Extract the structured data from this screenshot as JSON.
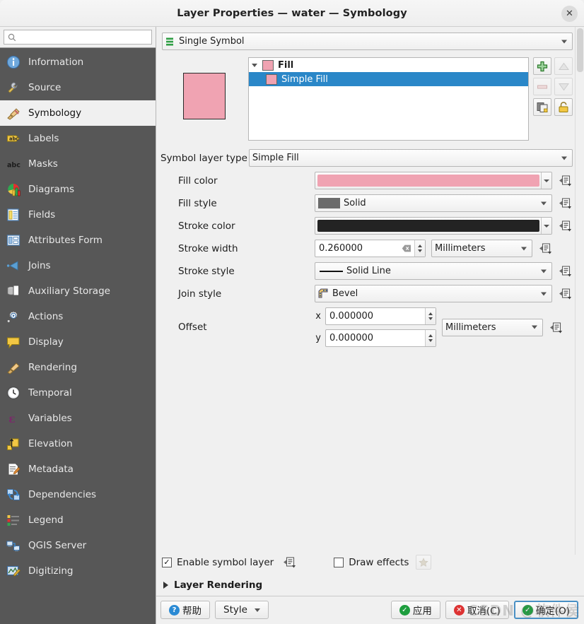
{
  "window": {
    "title": "Layer Properties — water — Symbology",
    "close_label": "✕"
  },
  "sidebar": {
    "search_value": "",
    "search_placeholder": "",
    "items": [
      {
        "label": "Information",
        "icon": "information-icon",
        "selected": false
      },
      {
        "label": "Source",
        "icon": "source-icon",
        "selected": false
      },
      {
        "label": "Symbology",
        "icon": "symbology-icon",
        "selected": true
      },
      {
        "label": "Labels",
        "icon": "labels-icon",
        "selected": false
      },
      {
        "label": "Masks",
        "icon": "masks-icon",
        "selected": false
      },
      {
        "label": "Diagrams",
        "icon": "diagrams-icon",
        "selected": false
      },
      {
        "label": "Fields",
        "icon": "fields-icon",
        "selected": false
      },
      {
        "label": "Attributes Form",
        "icon": "attributes-form-icon",
        "selected": false
      },
      {
        "label": "Joins",
        "icon": "joins-icon",
        "selected": false
      },
      {
        "label": "Auxiliary Storage",
        "icon": "auxiliary-storage-icon",
        "selected": false
      },
      {
        "label": "Actions",
        "icon": "actions-icon",
        "selected": false
      },
      {
        "label": "Display",
        "icon": "display-icon",
        "selected": false
      },
      {
        "label": "Rendering",
        "icon": "rendering-icon",
        "selected": false
      },
      {
        "label": "Temporal",
        "icon": "temporal-icon",
        "selected": false
      },
      {
        "label": "Variables",
        "icon": "variables-icon",
        "selected": false
      },
      {
        "label": "Elevation",
        "icon": "elevation-icon",
        "selected": false
      },
      {
        "label": "Metadata",
        "icon": "metadata-icon",
        "selected": false
      },
      {
        "label": "Dependencies",
        "icon": "dependencies-icon",
        "selected": false
      },
      {
        "label": "Legend",
        "icon": "legend-icon",
        "selected": false
      },
      {
        "label": "QGIS Server",
        "icon": "qgis-server-icon",
        "selected": false
      },
      {
        "label": "Digitizing",
        "icon": "digitizing-icon",
        "selected": false
      }
    ]
  },
  "symbology": {
    "renderer": "Single Symbol",
    "preview_color": "#f0a3b2",
    "tree": [
      {
        "label": "Fill",
        "swatch": "#f0a3b2",
        "level": 0,
        "selected": false,
        "expanded": true
      },
      {
        "label": "Simple Fill",
        "swatch": "#f0a3b2",
        "level": 1,
        "selected": true
      }
    ],
    "tools": [
      {
        "name": "add-symbol-layer-button",
        "icon": "plus-icon",
        "enabled": true
      },
      {
        "name": "move-up-button",
        "icon": "triangle-up-icon",
        "enabled": false
      },
      {
        "name": "remove-symbol-layer-button",
        "icon": "minus-icon",
        "enabled": false
      },
      {
        "name": "move-down-button",
        "icon": "triangle-down-icon",
        "enabled": false
      },
      {
        "name": "duplicate-symbol-layer-button",
        "icon": "duplicate-icon",
        "enabled": true
      },
      {
        "name": "lock-layer-button",
        "icon": "lock-icon",
        "enabled": true
      }
    ],
    "symbol_layer_type_label": "Symbol layer type",
    "symbol_layer_type_value": "Simple Fill",
    "fields": {
      "fill_color_label": "Fill color",
      "fill_color_value": "#f0a3b2",
      "fill_style_label": "Fill style",
      "fill_style_value": "Solid",
      "stroke_color_label": "Stroke color",
      "stroke_color_value": "#232323",
      "stroke_width_label": "Stroke width",
      "stroke_width_value": "0.260000",
      "stroke_width_unit": "Millimeters",
      "stroke_style_label": "Stroke style",
      "stroke_style_value": "Solid Line",
      "join_style_label": "Join style",
      "join_style_value": "Bevel",
      "offset_label": "Offset",
      "offset_x_prefix": "x",
      "offset_x_value": "0.000000",
      "offset_y_prefix": "y",
      "offset_y_value": "0.000000",
      "offset_unit": "Millimeters"
    }
  },
  "bottom": {
    "enable_symbol_layer_label": "Enable symbol layer",
    "enable_symbol_layer_checked": "✓",
    "draw_effects_label": "Draw effects",
    "draw_effects_checked": "",
    "layer_rendering_label": "Layer Rendering"
  },
  "buttons": {
    "help": "帮助",
    "style": "Style",
    "apply": "应用",
    "cancel": "取消(C)",
    "ok": "确定(O)"
  },
  "watermark": "CSDN @软件侯"
}
